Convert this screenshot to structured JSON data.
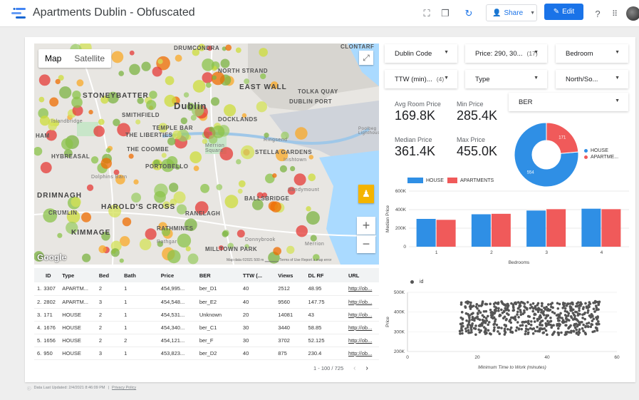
{
  "app": {
    "title": "Apartments Dublin - Obfuscated",
    "share_label": "Share",
    "edit_label": "Edit"
  },
  "map": {
    "tabs": [
      "Map",
      "Satellite"
    ],
    "labels": {
      "drumcondra": "DRUMCONDRA",
      "clontarf": "CLONTARF",
      "north_strand": "NORTH STRAND",
      "east_wall": "EAST WALL",
      "tolka_quay": "TOLKA QUAY",
      "dublin_port": "DUBLIN PORT",
      "stoneybatter": "STONEYBATTER",
      "islandbridge": "Islandbridge",
      "smithfield": "SMITHFIELD",
      "dublin": "Dublin",
      "temple_bar": "TEMPLE BAR",
      "docklands": "DOCKLANDS",
      "poolbeg": "Poolbeg Lighthouse",
      "ham": "HAM",
      "liberties": "THE LIBERTIES",
      "ringsend": "Ringsend",
      "coombe": "THE COOMBE",
      "merrion_sq": "Merrion Square",
      "stella": "STELLA GARDENS",
      "irishtown": "Irishtown",
      "hybreasal": "HYBREASAL",
      "portobello": "PORTOBELLO",
      "dolphins": "Dolphins Barn",
      "sandymount": "Sandymount",
      "drimnagh": "DRIMNAGH",
      "ballsbridge": "BALLSBRIDGE",
      "harolds": "HAROLD'S CROSS",
      "crumlin": "CRUMLIN",
      "ranelagh": "RANELAGH",
      "kimmage": "KIMMAGE",
      "rathmines": "RATHMINES",
      "rathgar": "Rathgar",
      "donnybrook": "Donnybrook",
      "milltown": "MILLTOWN PARK",
      "merrion": "Merrion"
    },
    "google": "Google",
    "footer": "Map data ©2021  500 m ▁▁▁▁▁  Terms of Use  Report a map error"
  },
  "filters": [
    {
      "label": "Dublin Code",
      "count": ""
    },
    {
      "label": "Price: 290, 30...",
      "count": "(17)"
    },
    {
      "label": "Bedroom",
      "count": ""
    },
    {
      "label": "TTW (min)...",
      "count": "(4)"
    },
    {
      "label": "Type",
      "count": ""
    },
    {
      "label": "North/So...",
      "count": ""
    },
    {
      "label": "BER",
      "count": ""
    }
  ],
  "kpis": [
    {
      "label": "Avg Room Price",
      "value": "169.8K"
    },
    {
      "label": "Min Price",
      "value": "285.4K"
    },
    {
      "label": "Median Price",
      "value": "361.4K"
    },
    {
      "label": "Max Price",
      "value": "455.0K"
    }
  ],
  "colors": {
    "house": "#2f8fe5",
    "apartments": "#f05a5a",
    "accent": "#1a73e8",
    "dots": "#555555"
  },
  "chart_data": [
    {
      "type": "pie",
      "labels": [
        "HOUSE",
        "APARTME..."
      ],
      "values": [
        554,
        171
      ]
    },
    {
      "type": "bar",
      "categories": [
        "1",
        "2",
        "3",
        "4"
      ],
      "series": [
        {
          "name": "HOUSE",
          "values": [
            300000,
            350000,
            390000,
            410000
          ]
        },
        {
          "name": "APARTMENTS",
          "values": [
            290000,
            355000,
            405000,
            405000
          ]
        }
      ],
      "xlabel": "Bedrooms",
      "ylabel": "Median Price",
      "yticks": [
        "0",
        "200K",
        "400K",
        "600K"
      ],
      "ylim": [
        0,
        600000
      ],
      "grid": true,
      "legend": "top"
    },
    {
      "type": "scatter",
      "series_name": "id",
      "xlabel": "Minimum Time to Work (minutes)",
      "ylabel": "Price",
      "xticks": [
        "0",
        "20",
        "40",
        "60"
      ],
      "yticks": [
        "200K",
        "300K",
        "400K",
        "500K"
      ],
      "xlim": [
        0,
        60
      ],
      "ylim": [
        200000,
        500000
      ],
      "note": "dense cloud of ~725 points spanning x 15–55 and y 285K–455K"
    }
  ],
  "table": {
    "columns": [
      "ID",
      "Type",
      "Bed",
      "Bath",
      "Price",
      "BER",
      "TTW (...",
      "Views",
      "DL RF",
      "URL"
    ],
    "rows": [
      [
        "1.",
        "3307",
        "APARTM...",
        "2",
        "1",
        "454,995...",
        "ber_D1",
        "40",
        "2512",
        "48.95",
        "http://ob..."
      ],
      [
        "2.",
        "2802",
        "APARTM...",
        "3",
        "1",
        "454,548...",
        "ber_E2",
        "40",
        "9560",
        "147.75",
        "http://ob..."
      ],
      [
        "3.",
        "171",
        "HOUSE",
        "2",
        "1",
        "454,531...",
        "Unknown",
        "20",
        "14081",
        "43",
        "http://ob..."
      ],
      [
        "4.",
        "1676",
        "HOUSE",
        "2",
        "1",
        "454,340...",
        "ber_C1",
        "30",
        "3440",
        "58.85",
        "http://ob..."
      ],
      [
        "5.",
        "1656",
        "HOUSE",
        "2",
        "2",
        "454,121...",
        "ber_F",
        "30",
        "3702",
        "52.125",
        "http://ob..."
      ],
      [
        "6.",
        "950",
        "HOUSE",
        "3",
        "1",
        "453,823...",
        "ber_D2",
        "40",
        "875",
        "230.4",
        "http://ob..."
      ]
    ],
    "pagination": "1 - 100 / 725"
  },
  "footer": {
    "updated": "Data Last Updated: 2/4/2021 8:46:09 PM",
    "privacy": "Privacy Policy"
  }
}
